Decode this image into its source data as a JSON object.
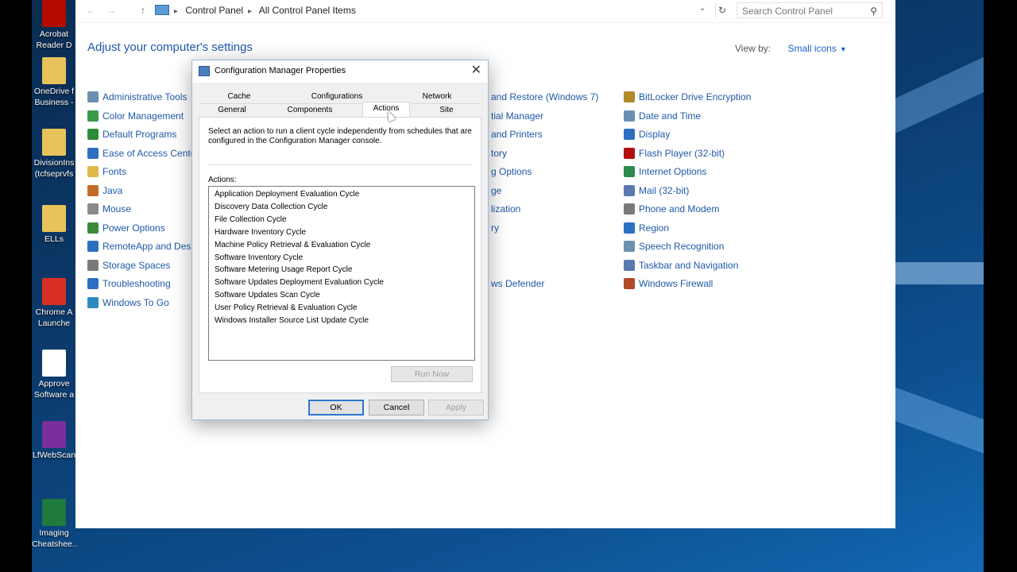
{
  "desktop": {
    "icons": [
      {
        "label": "Acrobat\nReader D",
        "icon": "acrobat-icon",
        "color": "#b30b00"
      },
      {
        "label": "OneDrive f\nBusiness -",
        "icon": "onedrive-folder-icon",
        "color": "#e8c25a"
      },
      {
        "label": "DivisionIns\n(tcfseprvfs",
        "icon": "folder-icon",
        "color": "#e8c25a"
      },
      {
        "label": "ELLs",
        "icon": "folder-icon",
        "color": "#e8c25a"
      },
      {
        "label": "Chrome A\nLaunche",
        "icon": "chrome-app-launcher-icon",
        "color": "#d93025"
      },
      {
        "label": "Approve\nSoftware a",
        "icon": "approved-software-icon",
        "color": "#ffffff"
      },
      {
        "label": "LfWebScan",
        "icon": "winrar-icon",
        "color": "#7a2f9c"
      },
      {
        "label": "Imaging\nCheatshee...",
        "icon": "spreadsheet-icon",
        "color": "#1e7a3d"
      }
    ]
  },
  "control_panel": {
    "breadcrumb": [
      "Control Panel",
      "All Control Panel Items"
    ],
    "search_placeholder": "Search Control Panel",
    "heading": "Adjust your computer's settings",
    "view_by_label": "View by:",
    "view_by_value": "Small icons",
    "col1": [
      {
        "label": "Administrative Tools",
        "icon": "admin-tools-icon",
        "color": "#6a8fb0"
      },
      {
        "label": "Color Management",
        "icon": "color-management-icon",
        "color": "#3a9a4a"
      },
      {
        "label": "Default Programs",
        "icon": "default-programs-icon",
        "color": "#2f8a3a"
      },
      {
        "label": "Ease of Access Center",
        "icon": "ease-of-access-icon",
        "color": "#2d6fc0"
      },
      {
        "label": "Fonts",
        "icon": "fonts-icon",
        "color": "#e0b84a"
      },
      {
        "label": "Java",
        "icon": "java-icon",
        "color": "#c46a2a"
      },
      {
        "label": "Mouse",
        "icon": "mouse-icon",
        "color": "#8a8a8a"
      },
      {
        "label": "Power Options",
        "icon": "power-options-icon",
        "color": "#3b8a3b"
      },
      {
        "label": "RemoteApp and Deskto",
        "icon": "remoteapp-icon",
        "color": "#2d6fc0"
      },
      {
        "label": "Storage Spaces",
        "icon": "storage-spaces-icon",
        "color": "#7a7a7a"
      },
      {
        "label": "Troubleshooting",
        "icon": "troubleshooting-icon",
        "color": "#2d6fc0"
      },
      {
        "label": "Windows To Go",
        "icon": "windows-to-go-icon",
        "color": "#2d8ac0"
      }
    ],
    "col2": [
      {
        "label": "and Restore (Windows 7)"
      },
      {
        "label": "tial Manager"
      },
      {
        "label": "and Printers"
      },
      {
        "label": "tory"
      },
      {
        "label": "g Options"
      },
      {
        "label": "ge"
      },
      {
        "label": "lization"
      },
      {
        "label": "ry"
      },
      {
        "label": ""
      },
      {
        "label": ""
      },
      {
        "label": "ws Defender"
      }
    ],
    "col3": [
      {
        "label": "BitLocker Drive Encryption",
        "icon": "bitlocker-icon",
        "color": "#b08a2a"
      },
      {
        "label": "Date and Time",
        "icon": "date-time-icon",
        "color": "#6a8fb0"
      },
      {
        "label": "Display",
        "icon": "display-icon",
        "color": "#2d6fc0"
      },
      {
        "label": "Flash Player (32-bit)",
        "icon": "flash-player-icon",
        "color": "#b31010"
      },
      {
        "label": "Internet Options",
        "icon": "internet-options-icon",
        "color": "#2d8a4a"
      },
      {
        "label": "Mail (32-bit)",
        "icon": "mail-icon",
        "color": "#5a7ab0"
      },
      {
        "label": "Phone and Modem",
        "icon": "phone-modem-icon",
        "color": "#7a7a7a"
      },
      {
        "label": "Region",
        "icon": "region-icon",
        "color": "#2d6fc0"
      },
      {
        "label": "Speech Recognition",
        "icon": "speech-recognition-icon",
        "color": "#6a8fb0"
      },
      {
        "label": "Taskbar and Navigation",
        "icon": "taskbar-icon",
        "color": "#5a7ab0"
      },
      {
        "label": "Windows Firewall",
        "icon": "windows-firewall-icon",
        "color": "#b04a2a"
      }
    ]
  },
  "dialog": {
    "title": "Configuration Manager Properties",
    "tabs_row1": [
      "Cache",
      "Configurations",
      "Network"
    ],
    "tabs_row2": [
      "General",
      "Components",
      "Actions",
      "Site"
    ],
    "active_tab": "Actions",
    "description": "Select an action to run a client cycle independently from schedules that are configured in the Configuration Manager console.",
    "actions_label": "Actions:",
    "actions": [
      "Application Deployment Evaluation Cycle",
      "Discovery Data Collection Cycle",
      "File Collection Cycle",
      "Hardware Inventory Cycle",
      "Machine Policy Retrieval & Evaluation Cycle",
      "Software Inventory Cycle",
      "Software Metering Usage Report Cycle",
      "Software Updates Deployment Evaluation Cycle",
      "Software Updates Scan Cycle",
      "User Policy Retrieval & Evaluation Cycle",
      "Windows Installer Source List Update Cycle"
    ],
    "run_now_label": "Run Now",
    "ok_label": "OK",
    "cancel_label": "Cancel",
    "apply_label": "Apply"
  }
}
